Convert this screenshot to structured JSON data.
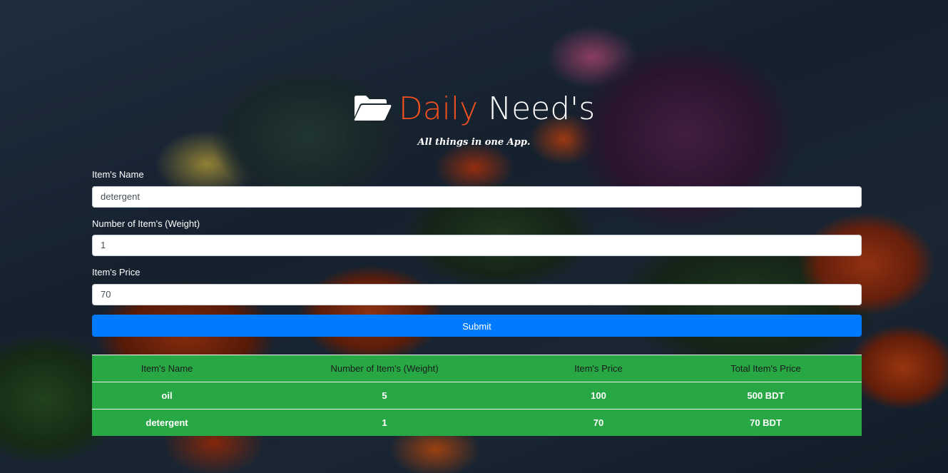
{
  "header": {
    "icon": "open-folder-icon",
    "title_accent": "Daily",
    "title_rest": " Need's",
    "subtitle": "All things in one App."
  },
  "colors": {
    "accent": "#f4511e",
    "submit": "#007bff",
    "table_bg": "#28a745"
  },
  "form": {
    "name_label": "Item's Name",
    "name_value": "detergent",
    "weight_label": "Number of Item's (Weight)",
    "weight_value": "1",
    "price_label": "Item's Price",
    "price_value": "70",
    "submit_label": "Submit"
  },
  "table": {
    "headers": [
      "Item's Name",
      "Number of Item's (Weight)",
      "Item's Price",
      "Total Item's Price"
    ],
    "rows": [
      [
        "oil",
        "5",
        "100",
        "500 BDT"
      ],
      [
        "detergent",
        "1",
        "70",
        "70 BDT"
      ]
    ]
  }
}
